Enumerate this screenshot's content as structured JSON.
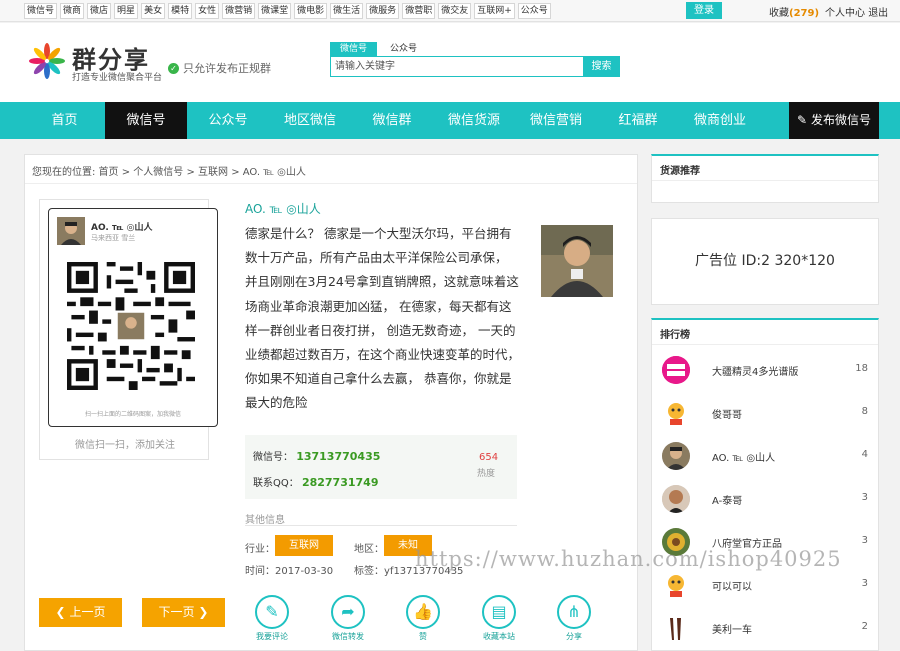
{
  "top_links": [
    "微信号",
    "微商",
    "微店",
    "明星",
    "美女",
    "模特",
    "女性",
    "微营销",
    "微课堂",
    "微电影",
    "微生活",
    "微服务",
    "微营职",
    "微交友",
    "互联网+",
    "公众号"
  ],
  "login_label": "登录",
  "favorites": {
    "label": "收藏",
    "count": "(279)"
  },
  "user_center": "个人中心",
  "logout": "退出",
  "logo": {
    "name": "群分享",
    "tagline": "打造专业微信聚合平台"
  },
  "verify_text": "只允许发布正规群",
  "search": {
    "tabs": [
      "微信号",
      "公众号"
    ],
    "placeholder": "请输入关键字",
    "button": "搜索"
  },
  "nav": [
    "首页",
    "微信号",
    "公众号",
    "地区微信",
    "微信群",
    "微信货源",
    "微信营销",
    "红福群",
    "微商创业"
  ],
  "publish_label": "发布微信号",
  "breadcrumb": "您现在的位置: 首页 > 个人微信号 > 互联网 > AO. ℡ ◎山人",
  "item": {
    "title": "AO. ℡ ◎山人",
    "description": "德家是什么？ 德家是一个大型沃尔玛，平台拥有数十万产品，所有产品由太平洋保险公司承保， 并且刚刚在3月24号拿到直销牌照，这就意味着这场商业革命浪潮更加凶猛， 在德家，每天都有这样一群创业者日夜打拼， 创造无数奇迹， 一天的业绩都超过数百万，在这个商业快速变革的时代， 你如果不知道自己拿什么去赢， 恭喜你，你就是最大的危险",
    "wechat_label": "微信号：",
    "wechat": "13713770435",
    "qq_label": "联系QQ：",
    "qq": "2827731749",
    "hits": "654",
    "hits_label": "热度",
    "other_info": "其他信息",
    "industry_label": "行业：",
    "industry": "互联网",
    "region_label": "地区：",
    "region": "未知",
    "time_label": "时间：",
    "time": "2017-03-30",
    "tags_label": "标签：",
    "tags": "yf13713770435"
  },
  "qr": {
    "name": "AO. ℡ ◎山人",
    "region": "马来西亚 雪兰",
    "tip": "扫一扫上面的二维码图案，加我微信",
    "caption": "微信扫一扫，添加关注"
  },
  "pager": {
    "prev": "上一页",
    "next": "下一页"
  },
  "actions": [
    "我要评论",
    "微信转发",
    "赞",
    "收藏本站",
    "分享"
  ],
  "sidebar": {
    "supply_title": "货源推荐",
    "ad": "广告位 ID:2 320*120",
    "rank_title": "排行榜",
    "rank": [
      {
        "name": "大疆精灵4多光谱版",
        "count": "18"
      },
      {
        "name": "俊哥哥",
        "count": "8"
      },
      {
        "name": "AO. ℡ ◎山人",
        "count": "4"
      },
      {
        "name": "A-泰哥",
        "count": "3"
      },
      {
        "name": "八府堂官方正品",
        "count": "3"
      },
      {
        "name": "可以可以",
        "count": "3"
      },
      {
        "name": "美利一车",
        "count": "2"
      }
    ]
  },
  "watermark": "https://www.huzhan.com/ishop40925",
  "colors": {
    "accent": "#1ec2c2",
    "orange": "#f5a300",
    "green_text": "#3a9a22"
  }
}
